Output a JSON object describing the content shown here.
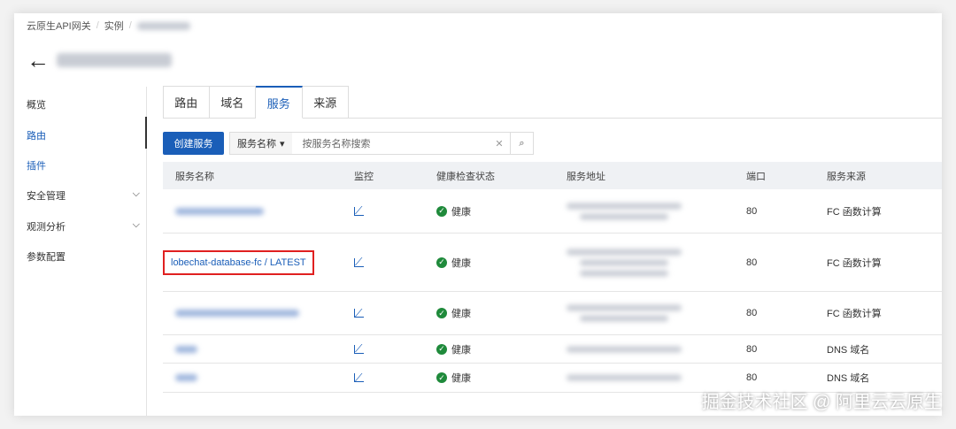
{
  "breadcrumb": [
    "云原生API网关",
    "实例"
  ],
  "sidebar": [
    {
      "label": "概览"
    },
    {
      "label": "路由"
    },
    {
      "label": "插件"
    },
    {
      "label": "安全管理"
    },
    {
      "label": "观测分析"
    },
    {
      "label": "参数配置"
    }
  ],
  "tabs": [
    "路由",
    "域名",
    "服务",
    "来源"
  ],
  "create_button": "创建服务",
  "search": {
    "field": "服务名称",
    "placeholder": "按服务名称搜索"
  },
  "columns": [
    "服务名称",
    "监控",
    "健康检查状态",
    "服务地址",
    "端口",
    "服务来源"
  ],
  "rows": [
    {
      "name": null,
      "status": "健康",
      "port": "80",
      "source": "FC 函数计算"
    },
    {
      "name": "lobechat-database-fc / LATEST",
      "status": "健康",
      "port": "80",
      "source": "FC 函数计算"
    },
    {
      "name": null,
      "status": "健康",
      "port": "80",
      "source": "FC 函数计算"
    },
    {
      "name": null,
      "status": "健康",
      "port": "80",
      "source": "DNS 域名"
    },
    {
      "name": null,
      "status": "健康",
      "port": "80",
      "source": "DNS 域名"
    }
  ],
  "watermark": "掘金技术社区 @ 阿里云云原生"
}
